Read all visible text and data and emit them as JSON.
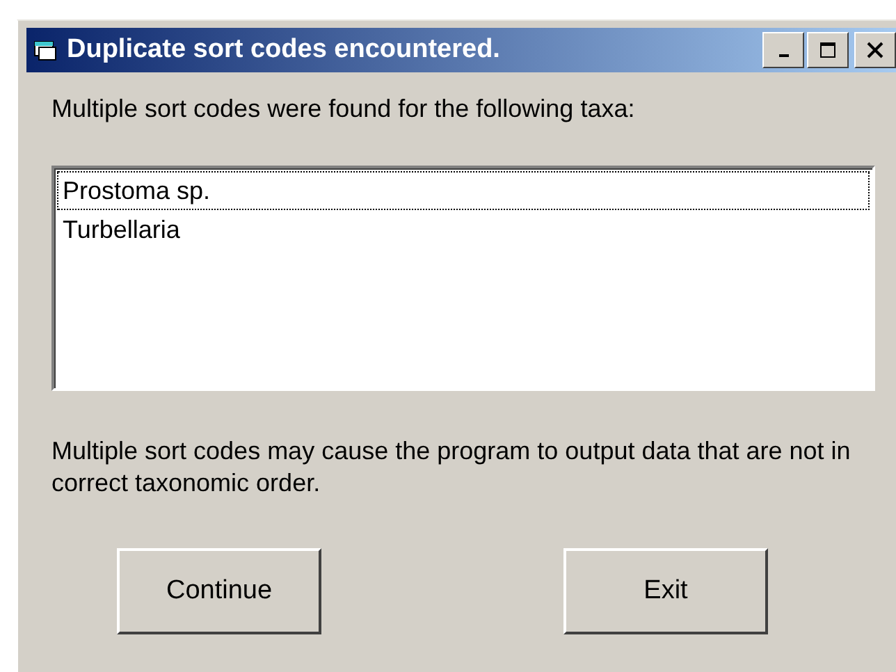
{
  "window": {
    "title": "Duplicate sort codes encountered."
  },
  "intro": "Multiple sort codes were found for the following taxa:",
  "list": [
    {
      "label": "Prostoma sp.",
      "focused": true
    },
    {
      "label": "Turbellaria",
      "focused": false
    }
  ],
  "note": "Multiple sort codes may cause the program to output data that are not in correct taxonomic order.",
  "buttons": [
    "Continue",
    "Exit"
  ]
}
